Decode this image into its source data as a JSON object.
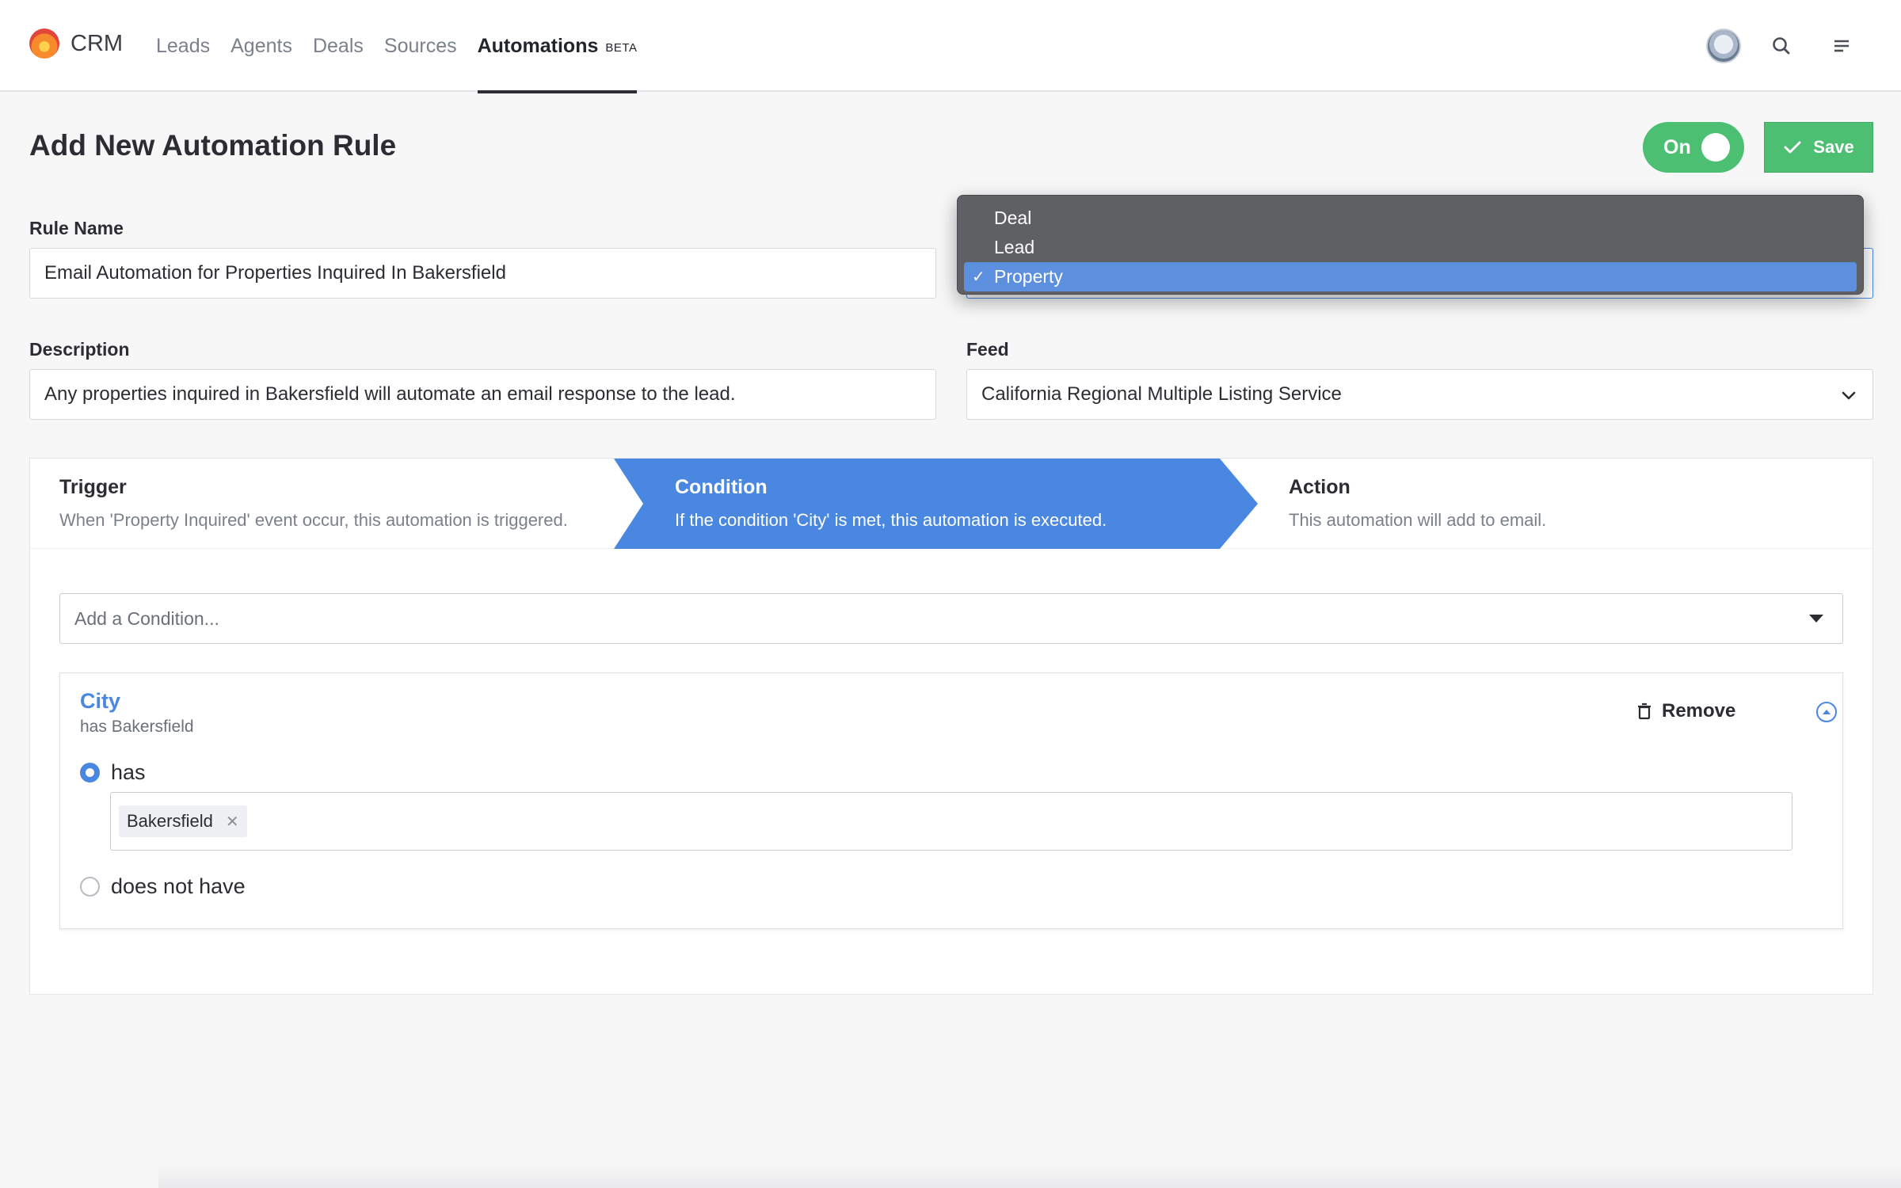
{
  "nav": {
    "brand": "CRM",
    "links": [
      "Leads",
      "Agents",
      "Deals",
      "Sources"
    ],
    "active_link": "Automations",
    "active_badge": "BETA"
  },
  "header": {
    "title": "Add New Automation Rule",
    "toggle_label": "On",
    "save_label": "Save"
  },
  "form": {
    "rule_name_label": "Rule Name",
    "rule_name_value": "Email Automation for Properties Inquired In Bakersfield",
    "description_label": "Description",
    "description_value": "Any properties inquired in Bakersfield will automate an email response to the lead.",
    "feed_label": "Feed",
    "feed_value": "California Regional Multiple Listing Service"
  },
  "dropdown": {
    "options": [
      "Deal",
      "Lead",
      "Property"
    ],
    "selected": "Property"
  },
  "steps": [
    {
      "title": "Trigger",
      "desc": "When 'Property Inquired' event occur, this automation is triggered."
    },
    {
      "title": "Condition",
      "desc": "If the condition 'City' is met, this automation is executed."
    },
    {
      "title": "Action",
      "desc": "This automation will add to email."
    }
  ],
  "condition": {
    "add_placeholder": "Add a Condition...",
    "title": "City",
    "subtitle": "has Bakersfield",
    "remove_label": "Remove",
    "option_has": "has",
    "option_not": "does not have",
    "tags": [
      "Bakersfield"
    ]
  },
  "colors": {
    "accent": "#4a87e0",
    "success": "#4cbf73"
  }
}
